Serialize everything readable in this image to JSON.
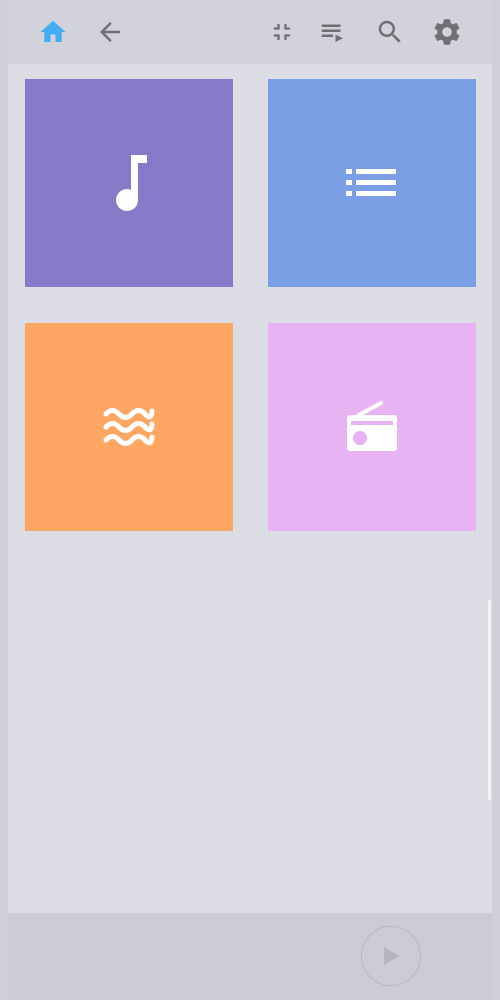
{
  "theme": {
    "background": "#dcdde4",
    "toolbar_bg": "#d2d3da",
    "icon_color": "#6f6f75",
    "active_icon_color": "#41aef2"
  },
  "toolbar": {
    "left_icons": [
      "home-icon",
      "back-arrow-icon"
    ],
    "right_icons": [
      "collapse-icon",
      "queue-icon",
      "search-icon",
      "gear-icon"
    ]
  },
  "tiles": [
    {
      "icon": "music-note-icon",
      "color": "#8879c8"
    },
    {
      "icon": "list-icon",
      "color": "#7a9fe5"
    },
    {
      "icon": "waves-icon",
      "color": "#fea764"
    },
    {
      "icon": "radio-icon",
      "color": "#e8b3f2"
    }
  ],
  "player": {
    "play_icon": "play-icon"
  }
}
